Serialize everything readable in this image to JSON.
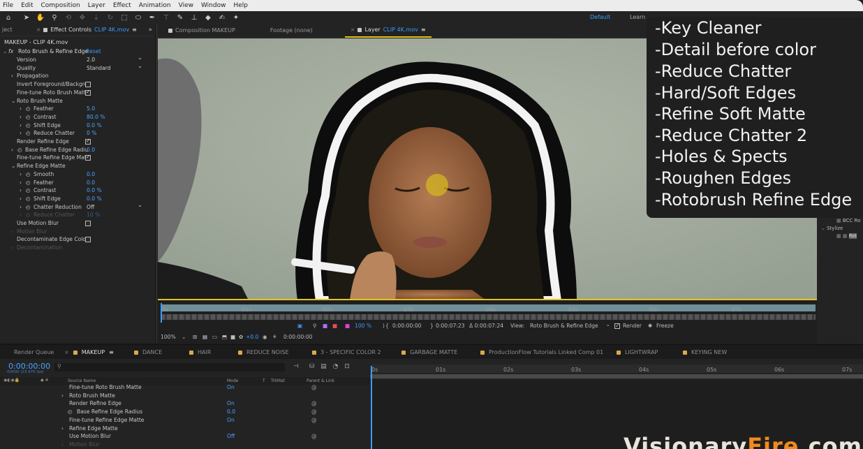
{
  "menubar": {
    "items": [
      "File",
      "Edit",
      "Composition",
      "Layer",
      "Effect",
      "Animation",
      "View",
      "Window",
      "Help"
    ]
  },
  "toolbar": {
    "workspace_default": "Default",
    "workspace_learn": "Learn"
  },
  "effect_controls": {
    "panel_left_tab": "ject",
    "tab_label": "Effect Controls",
    "tab_clip": "CLIP 4K.mov",
    "header": "MAKEUP - CLIP 4K.mov",
    "fx_glyph": "fx",
    "effect_name": "Roto Brush & Refine Edge",
    "reset_label": "Reset",
    "rows": [
      {
        "label": "Version",
        "value": "2.0",
        "kind": "dropdown",
        "indent": 0
      },
      {
        "label": "Quality",
        "value": "Standard",
        "kind": "dropdown",
        "indent": 0
      },
      {
        "label": "Propagation",
        "value": "",
        "kind": "group",
        "indent": 0
      },
      {
        "label": "Invert Foreground/Backgro",
        "value": "",
        "kind": "checkbox",
        "checked": false,
        "indent": 0
      },
      {
        "label": "Fine-tune Roto Brush Matte",
        "value": "",
        "kind": "checkbox",
        "checked": true,
        "indent": 0
      },
      {
        "label": "Roto Brush Matte",
        "value": "",
        "kind": "group-open",
        "indent": 0
      },
      {
        "label": "Feather",
        "value": "5.0",
        "kind": "value",
        "indent": 1
      },
      {
        "label": "Contrast",
        "value": "80.0 %",
        "kind": "value",
        "indent": 1
      },
      {
        "label": "Shift Edge",
        "value": "0.0 %",
        "kind": "value",
        "indent": 1
      },
      {
        "label": "Reduce Chatter",
        "value": "0 %",
        "kind": "value",
        "indent": 1
      },
      {
        "label": "Render Refine Edge",
        "value": "",
        "kind": "checkbox",
        "checked": true,
        "indent": 0
      },
      {
        "label": "Base Refine Edge Radiu",
        "value": "0.0",
        "kind": "value",
        "indent": 0
      },
      {
        "label": "Fine-tune Refine Edge Matt",
        "value": "",
        "kind": "checkbox",
        "checked": true,
        "indent": 0
      },
      {
        "label": "Refine Edge Matte",
        "value": "",
        "kind": "group-open",
        "indent": 0
      },
      {
        "label": "Smooth",
        "value": "0.0",
        "kind": "value",
        "indent": 1
      },
      {
        "label": "Feather",
        "value": "0.0",
        "kind": "value",
        "indent": 1
      },
      {
        "label": "Contrast",
        "value": "0.0 %",
        "kind": "value",
        "indent": 1
      },
      {
        "label": "Shift Edge",
        "value": "0.0 %",
        "kind": "value",
        "indent": 1
      },
      {
        "label": "Chatter Reduction",
        "value": "Off",
        "kind": "dropdown",
        "indent": 1
      },
      {
        "label": "Reduce Chatter",
        "value": "10 %",
        "kind": "dim",
        "indent": 1
      },
      {
        "label": "Use Motion Blur",
        "value": "",
        "kind": "checkbox",
        "checked": false,
        "indent": 0
      },
      {
        "label": "Motion Blur",
        "value": "",
        "kind": "dim-group",
        "indent": 0
      },
      {
        "label": "Decontaminate Edge Colors",
        "value": "",
        "kind": "checkbox",
        "checked": false,
        "indent": 0
      },
      {
        "label": "Decontamination",
        "value": "",
        "kind": "dim-group",
        "indent": 0
      }
    ]
  },
  "viewer": {
    "tab_composition": "Composition MAKEUP",
    "tab_footage": "Footage (none)",
    "tab_layer": "Layer",
    "tab_layer_clip": "CLIP 4K.mov",
    "ruler": [
      "0s",
      "01s",
      "02s",
      "03s",
      "04s",
      "05s",
      "06s",
      "07s"
    ],
    "percent_100": "100 %",
    "time_in": "0:00:00:00",
    "time_out": "0:00:07:23",
    "duration": "Δ 0:00:07:24",
    "view_label": "View:",
    "view_value": "Roto Brush & Refine Edge",
    "render_label": "Render",
    "freeze_label": "Freeze",
    "zoom": "100%",
    "exposure": "+0.0",
    "current_time": "0:00:00:00"
  },
  "overlay": {
    "items": [
      "-Key Cleaner",
      "-Detail before color",
      "-Reduce Chatter",
      "-Hard/Soft Edges",
      "-Refine Soft Matte",
      "-Reduce Chatter 2",
      "-Holes & Spects",
      "-Roughen Edges",
      "-Rotobrush Refine Edge"
    ]
  },
  "side": {
    "item1": "BCC Ro",
    "item2": "Stylize",
    "item3": "Rot"
  },
  "timeline": {
    "tabs": [
      "Render Queue",
      "MAKEUP",
      "DANCE",
      "HAIR",
      "REDUCE NOISE",
      "3 - SPECIFIC COLOR 2",
      "GARBAGE MATTE",
      "ProductionFlow Tutorials Linked Comp 01",
      "LIGHTWRAP",
      "KEYING NEW"
    ],
    "timecode": "0:00:00:00",
    "fps": "00000 (23.976 fps)",
    "col_source": "Source Name",
    "col_mode": "Mode",
    "col_t": "T",
    "col_trkmat": "TrkMat",
    "col_parent": "Parent & Link",
    "ruler": [
      "0s",
      "01s",
      "02s",
      "03s",
      "04s",
      "05s",
      "06s",
      "07s"
    ],
    "rows": [
      {
        "name": "Fine-tune Roto Brush Matte",
        "mode": "On",
        "dim": false,
        "parent": true
      },
      {
        "name": "Roto Brush Matte",
        "mode": "",
        "dim": false,
        "parent": false,
        "caret": true
      },
      {
        "name": "Render Refine Edge",
        "mode": "On",
        "dim": false,
        "parent": true
      },
      {
        "name": "Base Refine Edge Radius",
        "mode": "0.0",
        "dim": false,
        "parent": true,
        "stopwatch": true
      },
      {
        "name": "Fine-tune Refine Edge Matte",
        "mode": "On",
        "dim": false,
        "parent": true
      },
      {
        "name": "Refine Edge Matte",
        "mode": "",
        "dim": false,
        "parent": false,
        "caret": true
      },
      {
        "name": "Use Motion Blur",
        "mode": "Off",
        "dim": false,
        "parent": true
      },
      {
        "name": "Motion Blur",
        "mode": "",
        "dim": true,
        "parent": false,
        "caret": true
      }
    ]
  },
  "watermark": {
    "part1": "Visionary",
    "part2": "Fire",
    "part3": ".com"
  }
}
